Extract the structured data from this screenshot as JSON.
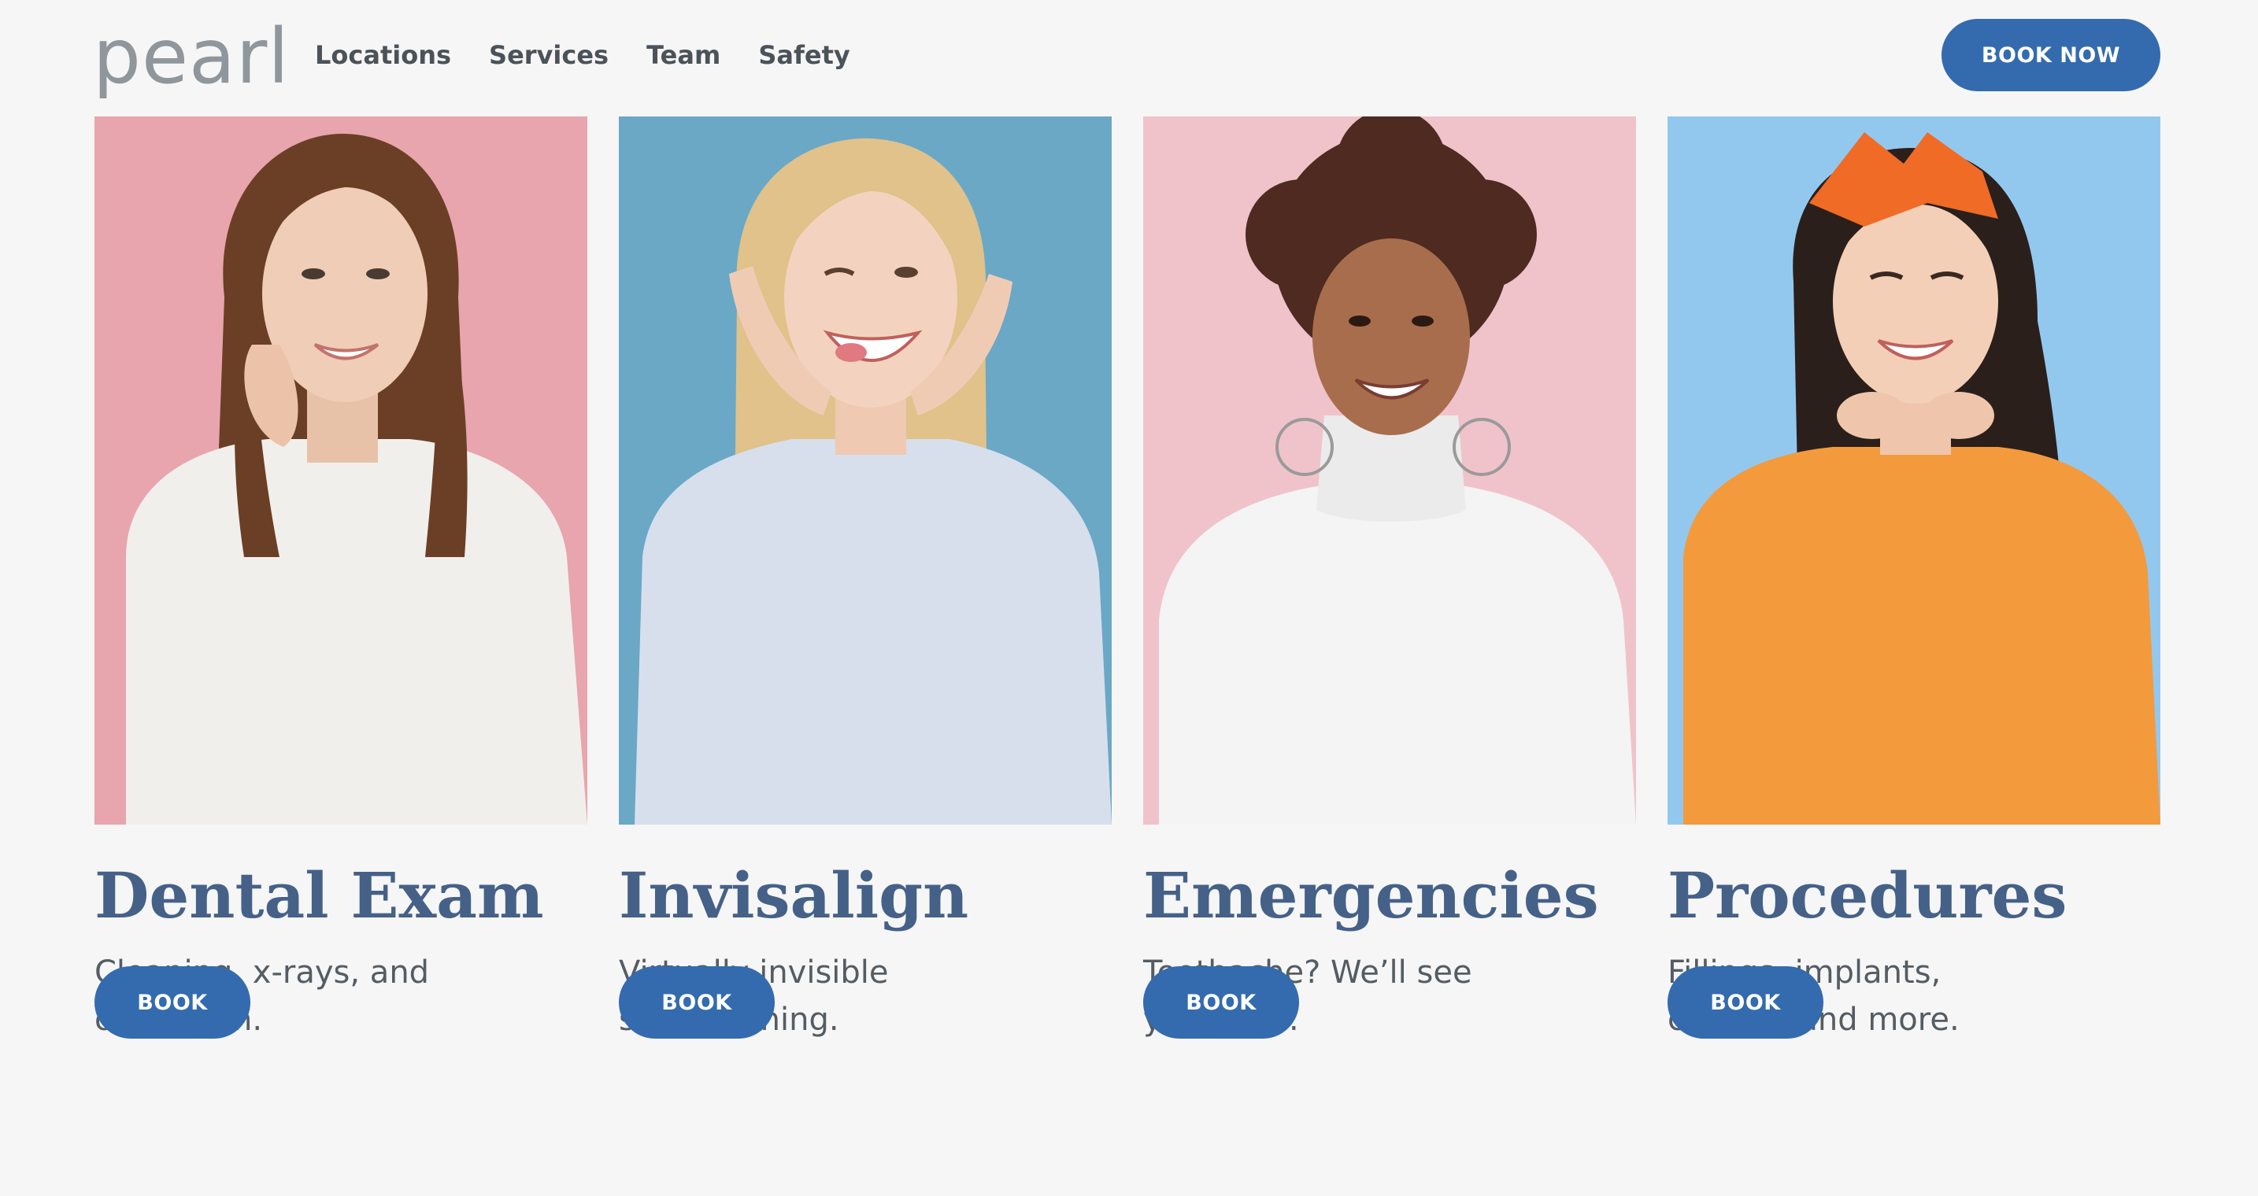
{
  "header": {
    "logo_text": "pearl",
    "nav": [
      "Locations",
      "Services",
      "Team",
      "Safety"
    ],
    "book_now_label": "BOOK NOW"
  },
  "cards": [
    {
      "title": "Dental Exam",
      "description": "Cleaning, x-rays, and oral exam.",
      "button_label": "BOOK",
      "photo_bg": "#e8a5ad"
    },
    {
      "title": "Invisalign",
      "description": "Virtually invisible straightening.",
      "button_label": "BOOK",
      "photo_bg": "#6aa8c6"
    },
    {
      "title": "Emergencies",
      "description": "Toothache? We’ll see you ASAP.",
      "button_label": "BOOK",
      "photo_bg": "#f0c3cb"
    },
    {
      "title": "Procedures",
      "description": "Fillings, implants, crowns, and more.",
      "button_label": "BOOK",
      "photo_bg": "#93c8ee"
    }
  ],
  "colors": {
    "accent": "#346bae",
    "heading": "#456188",
    "body_text": "#555c63",
    "background": "#f6f6f6"
  }
}
